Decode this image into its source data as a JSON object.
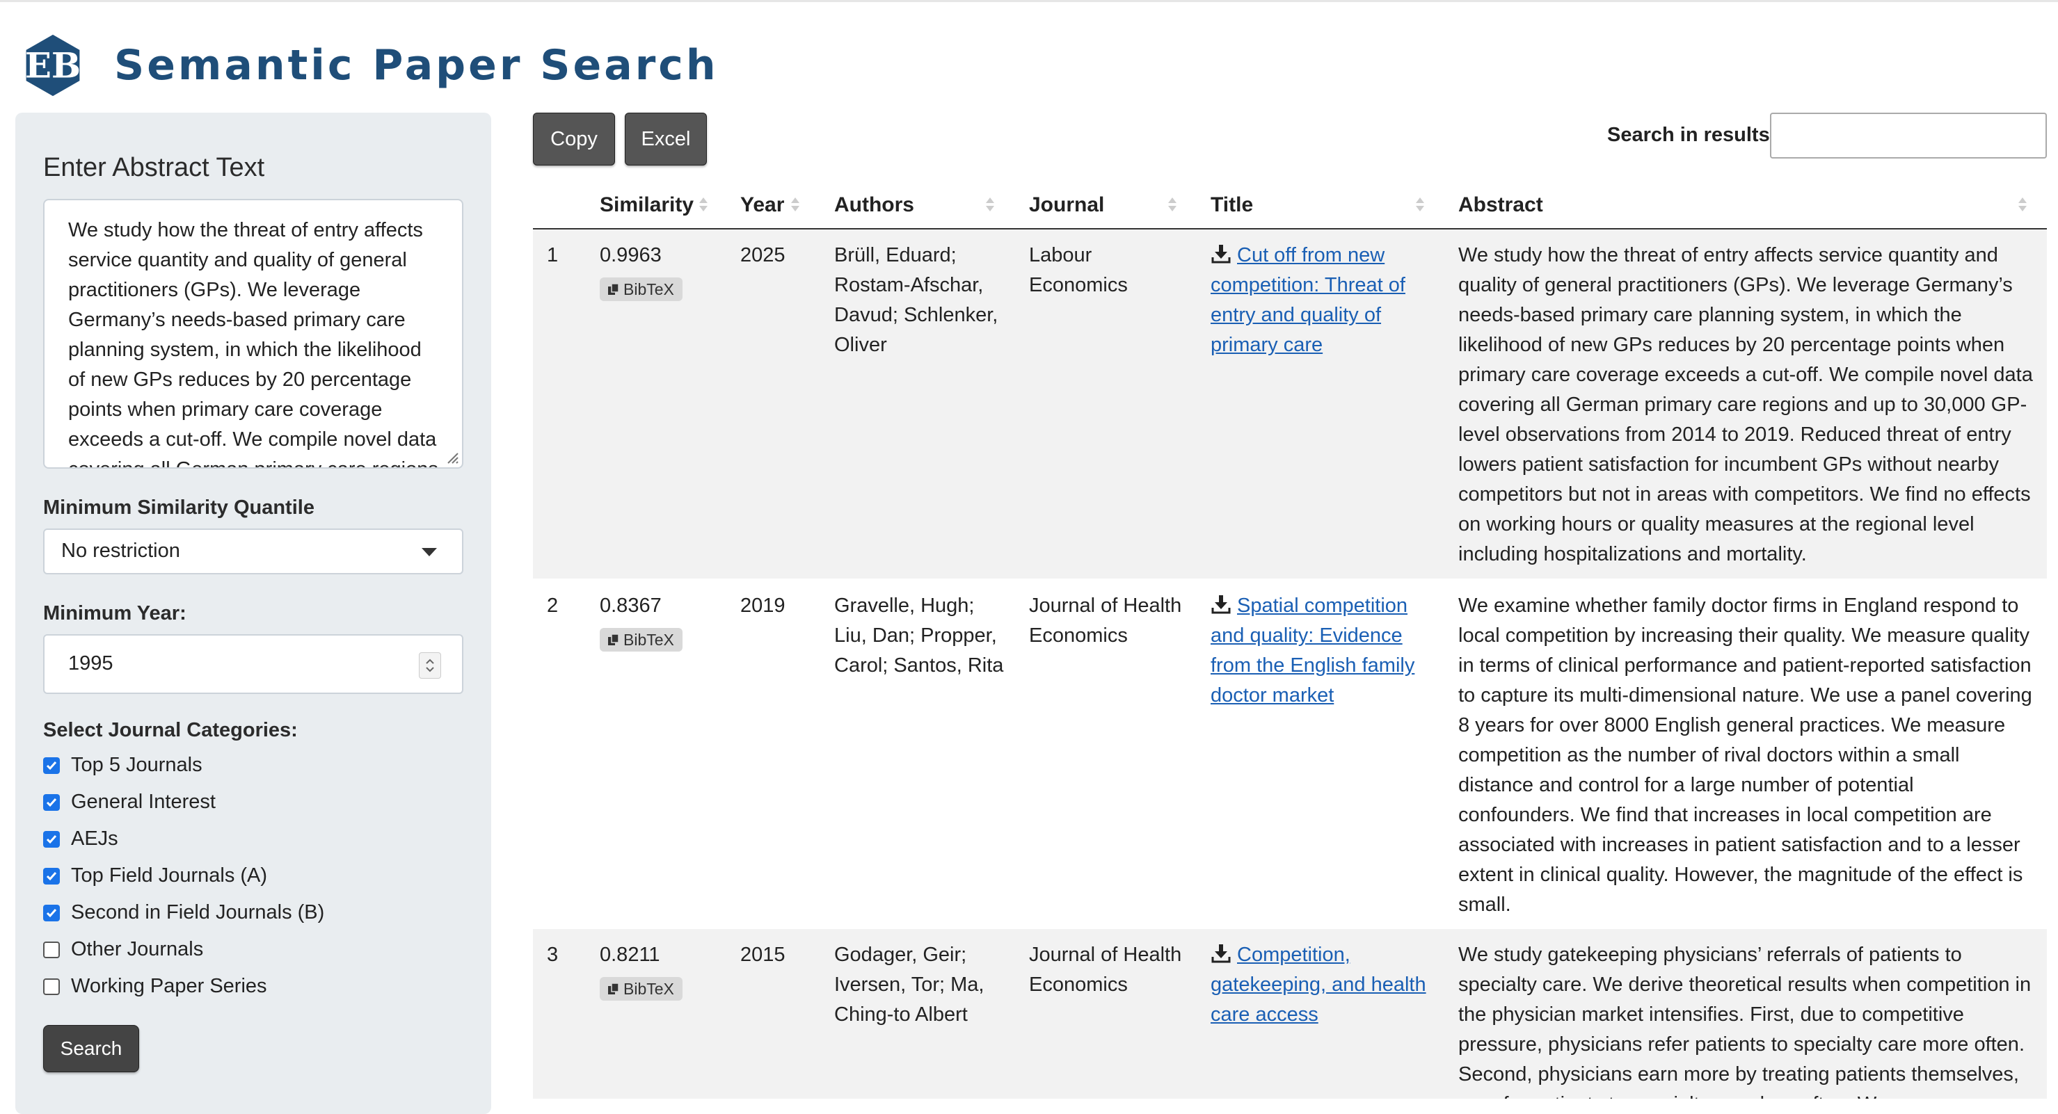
{
  "app": {
    "title": "Semantic Paper Search",
    "accent_color": "#1f4e79",
    "logo_icon": "eb-hexagon-logo"
  },
  "sidebar": {
    "abstract_label": "Enter Abstract Text",
    "abstract_value": " We study how the threat of entry affects service quantity and quality of general practitioners (GPs). We leverage Germany’s needs-based primary care planning system, in which the likelihood of new GPs reduces by 20 percentage points when primary care coverage exceeds a cut-off. We compile novel data covering all German primary care regions",
    "similarity_label": "Minimum Similarity Quantile",
    "similarity_value": "No restriction",
    "year_label": "Minimum Year:",
    "year_value": "1995",
    "categories_label": "Select Journal Categories:",
    "categories": [
      {
        "label": "Top 5 Journals",
        "checked": true
      },
      {
        "label": "General Interest",
        "checked": true
      },
      {
        "label": "AEJs",
        "checked": true
      },
      {
        "label": "Top Field Journals (A)",
        "checked": true
      },
      {
        "label": "Second in Field Journals (B)",
        "checked": true
      },
      {
        "label": "Other Journals",
        "checked": false
      },
      {
        "label": "Working Paper Series",
        "checked": false
      }
    ],
    "search_button": "Search"
  },
  "toolbar": {
    "copy_label": "Copy",
    "excel_label": "Excel",
    "search_results_label": "Search in results:",
    "search_results_value": ""
  },
  "table": {
    "columns": [
      "Similarity",
      "Year",
      "Authors",
      "Journal",
      "Title",
      "Abstract"
    ],
    "bibtex_label": "BibTeX",
    "rows": [
      {
        "index": "1",
        "similarity": "0.9963",
        "year": "2025",
        "authors": "Brüll, Eduard; Rostam-Afschar, Davud; Schlenker, Oliver",
        "journal": "Labour Economics",
        "title": "Cut off from new competition: Threat of entry and quality of primary care",
        "abstract": "We study how the threat of entry affects service quantity and quality of general practitioners (GPs). We leverage Germany’s needs-based primary care planning system, in which the likelihood of new GPs reduces by 20 percentage points when primary care coverage exceeds a cut-off. We compile novel data covering all German primary care regions and up to 30,000 GP-level observations from 2014 to 2019. Reduced threat of entry lowers patient satisfaction for incumbent GPs without nearby competitors but not in areas with competitors. We find no effects on working hours or quality measures at the regional level including hospitalizations and mortality."
      },
      {
        "index": "2",
        "similarity": "0.8367",
        "year": "2019",
        "authors": "Gravelle, Hugh; Liu, Dan; Propper, Carol; Santos, Rita",
        "journal": "Journal of Health Economics",
        "title": "Spatial competition and quality: Evidence from the English family doctor market",
        "abstract": "We examine whether family doctor firms in England respond to local competition by increasing their quality. We measure quality in terms of clinical performance and patient-reported satisfaction to capture its multi-dimensional nature. We use a panel covering 8 years for over 8000 English general practices. We measure competition as the number of rival doctors within a small distance and control for a large number of potential confounders. We find that increases in local competition are associated with increases in patient satisfaction and to a lesser extent in clinical quality. However, the magnitude of the effect is small."
      },
      {
        "index": "3",
        "similarity": "0.8211",
        "year": "2015",
        "authors": "Godager, Geir; Iversen, Tor; Ma, Ching-to Albert",
        "journal": "Journal of Health Economics",
        "title": "Competition, gatekeeping, and health care access",
        "abstract": "We study gatekeeping physicians’ referrals of patients to specialty care. We derive theoretical results when competition in the physician market intensifies. First, due to competitive pressure, physicians refer patients to specialty care more often. Second, physicians earn more by treating patients themselves, so refer patients to specialty care less often. We..."
      }
    ]
  }
}
